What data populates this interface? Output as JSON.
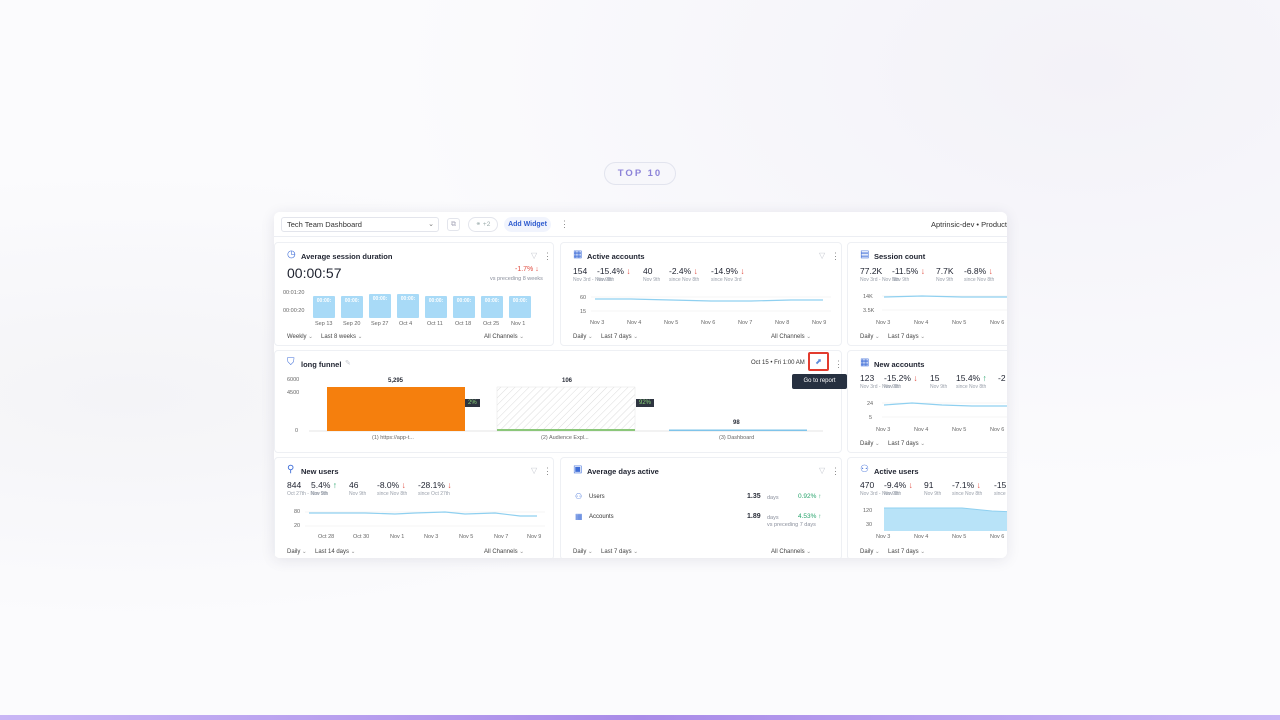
{
  "badge": "TOP 10",
  "toolbar": {
    "dashboard_name": "Tech Team Dashboard",
    "share_count": "+2",
    "add_widget": "Add Widget",
    "org": "Aptrinsic-dev • Producti"
  },
  "widgets": {
    "avg_session": {
      "title": "Average session duration",
      "value": "00:00:57",
      "change": "-1.7%",
      "change_note": "vs preceding 8 weeks",
      "y_ticks": [
        "00:01:20",
        "00:00:20"
      ],
      "bars": [
        "00:00:",
        "00:00:",
        "00:00:",
        "00:00:",
        "00:00:",
        "00:00:",
        "00:00:",
        "00:00:"
      ],
      "bar_levels": [
        0.62,
        0.62,
        0.68,
        0.66,
        0.6,
        0.6,
        0.62,
        0.6
      ],
      "x": [
        "Sep 13",
        "Sep 20",
        "Sep 27",
        "Oct 4",
        "Oct 11",
        "Oct 18",
        "Oct 25",
        "Nov 1"
      ],
      "footer": {
        "interval": "Weekly",
        "range": "Last 8 weeks",
        "channels": "All Channels"
      }
    },
    "active_accounts": {
      "title": "Active accounts",
      "kpis": [
        {
          "v": "154",
          "s": "Nov 3rd - Nov 9th"
        },
        {
          "v": "-15.4%",
          "s": "Nov 9th"
        },
        {
          "v": "40",
          "s": "Nov 9th"
        },
        {
          "v": "-2.4%",
          "s": "since Nov 8th"
        },
        {
          "v": "-14.9%",
          "s": "since Nov 3rd"
        }
      ],
      "y_ticks": [
        "60",
        "15"
      ],
      "x": [
        "Nov 3",
        "Nov 4",
        "Nov 5",
        "Nov 6",
        "Nov 7",
        "Nov 8",
        "Nov 9"
      ],
      "footer": {
        "interval": "Daily",
        "range": "Last 7 days",
        "channels": "All Channels"
      }
    },
    "session_count": {
      "title": "Session count",
      "kpis": [
        {
          "v": "77.2K",
          "s": "Nov 3rd - Nov 9th"
        },
        {
          "v": "-11.5%",
          "s": "Nov 9th"
        },
        {
          "v": "7.7K",
          "s": "Nov 9th"
        },
        {
          "v": "-6.8%",
          "s": "since Nov 8th"
        }
      ],
      "y_ticks": [
        "14K",
        "3.5K"
      ],
      "x": [
        "Nov 3",
        "Nov 4",
        "Nov 5",
        "Nov 6"
      ],
      "footer": {
        "interval": "Daily",
        "range": "Last 7 days"
      }
    },
    "funnel": {
      "title": "long funnel",
      "date": "Oct 15 • Fri 1:00 AM",
      "tooltip": "Go to report",
      "y_ticks": [
        "6000",
        "4500",
        "0"
      ],
      "steps": [
        {
          "label": "(1) https://app-t...",
          "value": "5,295",
          "level": 0.88
        },
        {
          "label": "(2) Audience Expl...",
          "value": "106",
          "level": 0.88
        },
        {
          "label": "(3) Dashboard",
          "value": "98",
          "level": 0.02
        }
      ],
      "conversions": [
        "2%",
        "92%"
      ]
    },
    "new_accounts": {
      "title": "New accounts",
      "kpis": [
        {
          "v": "123",
          "s": "Nov 3rd - Nov 9th"
        },
        {
          "v": "-15.2%",
          "s": "Nov 9th"
        },
        {
          "v": "15",
          "s": "Nov 9th"
        },
        {
          "v": "15.4%",
          "s": "since Nov 8th"
        },
        {
          "v": "-2",
          "s": ""
        }
      ],
      "y_ticks": [
        "24",
        "5"
      ],
      "x": [
        "Nov 3",
        "Nov 4",
        "Nov 5",
        "Nov 6"
      ],
      "footer": {
        "interval": "Daily",
        "range": "Last 7 days"
      }
    },
    "new_users": {
      "title": "New users",
      "kpis": [
        {
          "v": "844",
          "s": "Oct 27th - Nov 9th"
        },
        {
          "v": "5.4%",
          "s": "Nov 9th"
        },
        {
          "v": "46",
          "s": "Nov 9th"
        },
        {
          "v": "-8.0%",
          "s": "since Nov 8th"
        },
        {
          "v": "-28.1%",
          "s": "since Oct 27th"
        }
      ],
      "y_ticks": [
        "80",
        "20"
      ],
      "x": [
        "Oct 28",
        "Oct 30",
        "Nov 1",
        "Nov 3",
        "Nov 5",
        "Nov 7",
        "Nov 9"
      ],
      "footer": {
        "interval": "Daily",
        "range": "Last 14 days",
        "channels": "All Channels"
      }
    },
    "avg_days": {
      "title": "Average days active",
      "rows": [
        {
          "label": "Users",
          "value": "1.35",
          "unit": "days",
          "change": "0.92%"
        },
        {
          "label": "Accounts",
          "value": "1.89",
          "unit": "days",
          "change": "4.53%",
          "note": "vs preceding 7 days"
        }
      ],
      "footer": {
        "interval": "Daily",
        "range": "Last 7 days",
        "channels": "All Channels"
      }
    },
    "active_users": {
      "title": "Active users",
      "kpis": [
        {
          "v": "470",
          "s": "Nov 3rd - Nov 9th"
        },
        {
          "v": "-9.4%",
          "s": "Nov 9th"
        },
        {
          "v": "91",
          "s": "Nov 9th"
        },
        {
          "v": "-7.1%",
          "s": "since Nov 8th"
        },
        {
          "v": "-15.",
          "s": "since"
        }
      ],
      "y_ticks": [
        "120",
        "30"
      ],
      "x": [
        "Nov 3",
        "Nov 4",
        "Nov 5",
        "Nov 6"
      ],
      "footer": {
        "interval": "Daily",
        "range": "Last 7 days"
      }
    }
  }
}
